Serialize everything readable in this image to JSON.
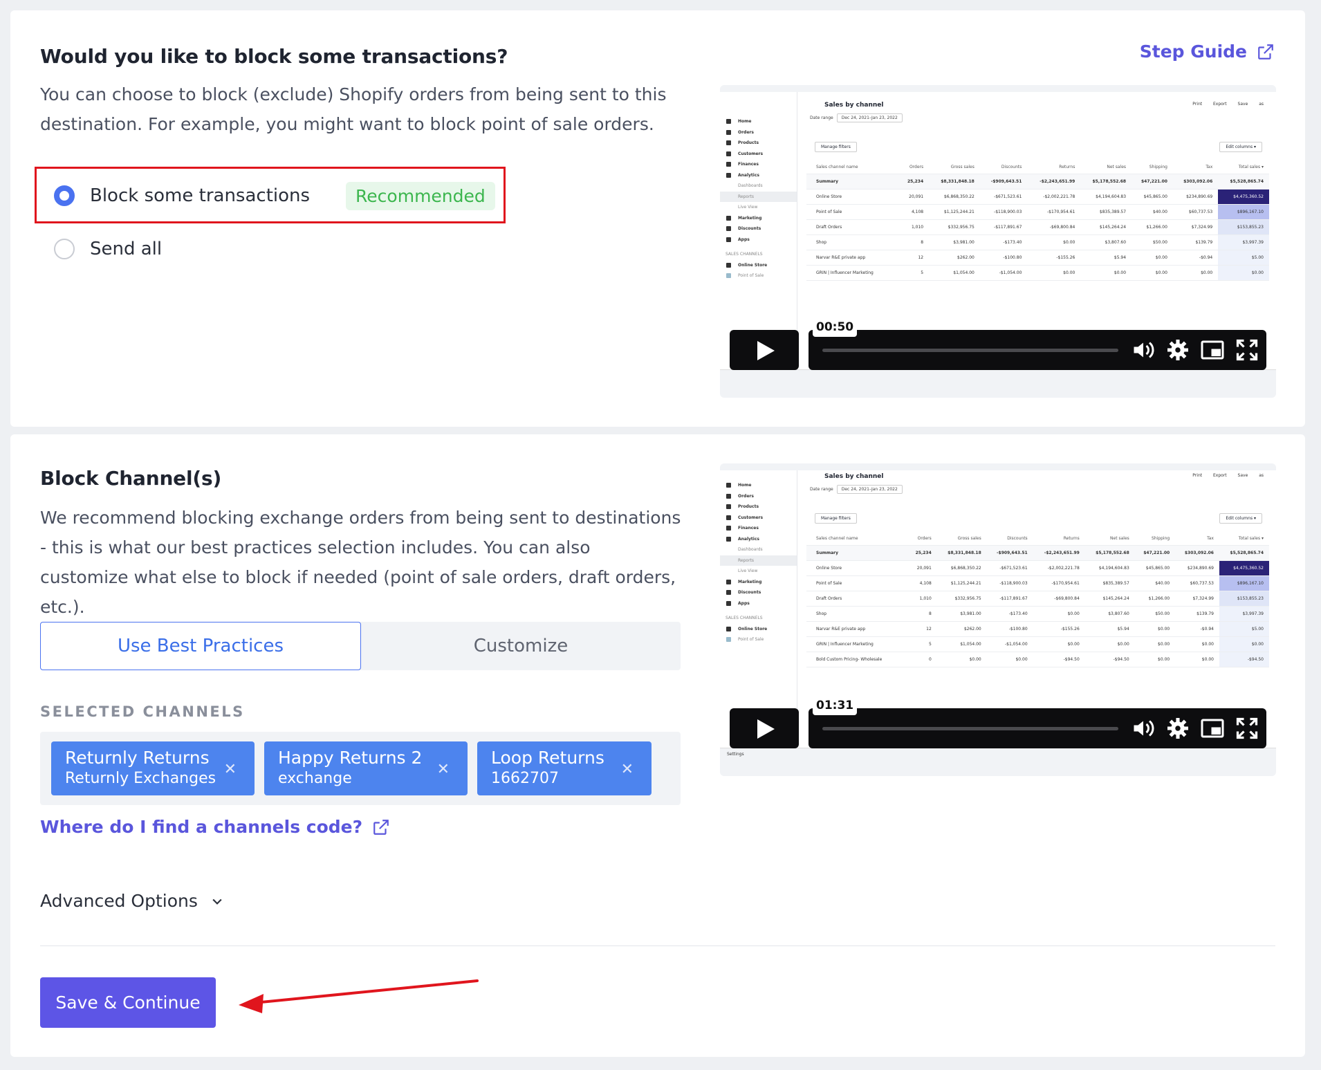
{
  "block": {
    "title": "Would you like to block some transactions?",
    "description": "You can choose to block (exclude) Shopify orders from being sent to this destination. For example, you might want to block point of sale orders.",
    "step_guide": "Step Guide",
    "options": [
      {
        "label": "Block some transactions",
        "selected": true,
        "badge": "Recommended"
      },
      {
        "label": "Send all",
        "selected": false
      }
    ]
  },
  "video": {
    "sidebar": [
      "Home",
      "Orders",
      "Products",
      "Customers",
      "Finances",
      "Analytics",
      "Dashboards",
      "Reports",
      "Live View",
      "Marketing",
      "Discounts",
      "Apps",
      "SALES CHANNELS",
      "Online Store",
      "Point of Sale"
    ],
    "title": "Sales by channel",
    "top_actions": "Print Export Save as",
    "date_range_label": "Date range",
    "date_range": "Dec 24, 2021–Jan 23, 2022",
    "manage_filters": "Manage filters",
    "edit_columns": "Edit columns ▾",
    "columns": [
      "Sales channel name",
      "Orders",
      "Gross sales",
      "Discounts",
      "Returns",
      "Net sales",
      "Shipping",
      "Tax",
      "Total sales ▾"
    ],
    "rows": [
      [
        "Summary",
        "25,234",
        "$8,331,848.18",
        "-$909,643.51",
        "-$2,243,651.99",
        "$5,178,552.68",
        "$47,221.00",
        "$303,092.06",
        "$5,528,865.74"
      ],
      [
        "Online Store",
        "20,091",
        "$6,868,350.22",
        "-$671,523.61",
        "-$2,002,221.78",
        "$4,194,604.83",
        "$45,865.00",
        "$234,890.69",
        "$4,475,360.52"
      ],
      [
        "Point of Sale",
        "4,108",
        "$1,125,244.21",
        "-$118,900.03",
        "-$170,954.61",
        "$835,389.57",
        "$40.00",
        "$60,737.53",
        "$896,167.10"
      ],
      [
        "Draft Orders",
        "1,010",
        "$332,956.75",
        "-$117,891.67",
        "-$69,800.84",
        "$145,264.24",
        "$1,266.00",
        "$7,324.99",
        "$153,855.23"
      ],
      [
        "Shop",
        "8",
        "$3,981.00",
        "-$173.40",
        "$0.00",
        "$3,807.60",
        "$50.00",
        "$139.79",
        "$3,997.39"
      ],
      [
        "Narvar R&E private app",
        "12",
        "$262.00",
        "-$100.80",
        "-$155.26",
        "$5.94",
        "$0.00",
        "-$0.94",
        "$5.00"
      ],
      [
        "GRIN | Influencer Marketing",
        "5",
        "$1,054.00",
        "-$1,054.00",
        "$0.00",
        "$0.00",
        "$0.00",
        "$0.00",
        "$0.00"
      ],
      [
        "Bold Custom Pricing- Wholesale",
        "0",
        "$0.00",
        "$0.00",
        "-$94.50",
        "-$94.50",
        "$0.00",
        "$0.00",
        "-$94.50"
      ]
    ],
    "time1": "00:50",
    "time2": "01:31",
    "settings": "Settings"
  },
  "channels": {
    "title": "Block Channel(s)",
    "description": "We recommend blocking exchange orders from being sent to destinations - this is what our best practices selection includes. You can also customize what else to block if needed (point of sale orders, draft orders, etc.).",
    "tabs": [
      "Use Best Practices",
      "Customize"
    ],
    "selected_label": "SELECTED CHANNELS",
    "chips": [
      {
        "name": "Returnly Returns",
        "code": "Returnly Exchanges"
      },
      {
        "name": "Happy Returns 2",
        "code": "exchange"
      },
      {
        "name": "Loop Returns",
        "code": "1662707"
      }
    ],
    "find_code_link": "Where do I find a channels code?",
    "advanced": "Advanced Options",
    "save": "Save & Continue"
  },
  "colors": {
    "accent": "#5d55e6",
    "chip": "#4d84ee",
    "recommended": "#3cb64e",
    "annotation": "#e0151d"
  }
}
